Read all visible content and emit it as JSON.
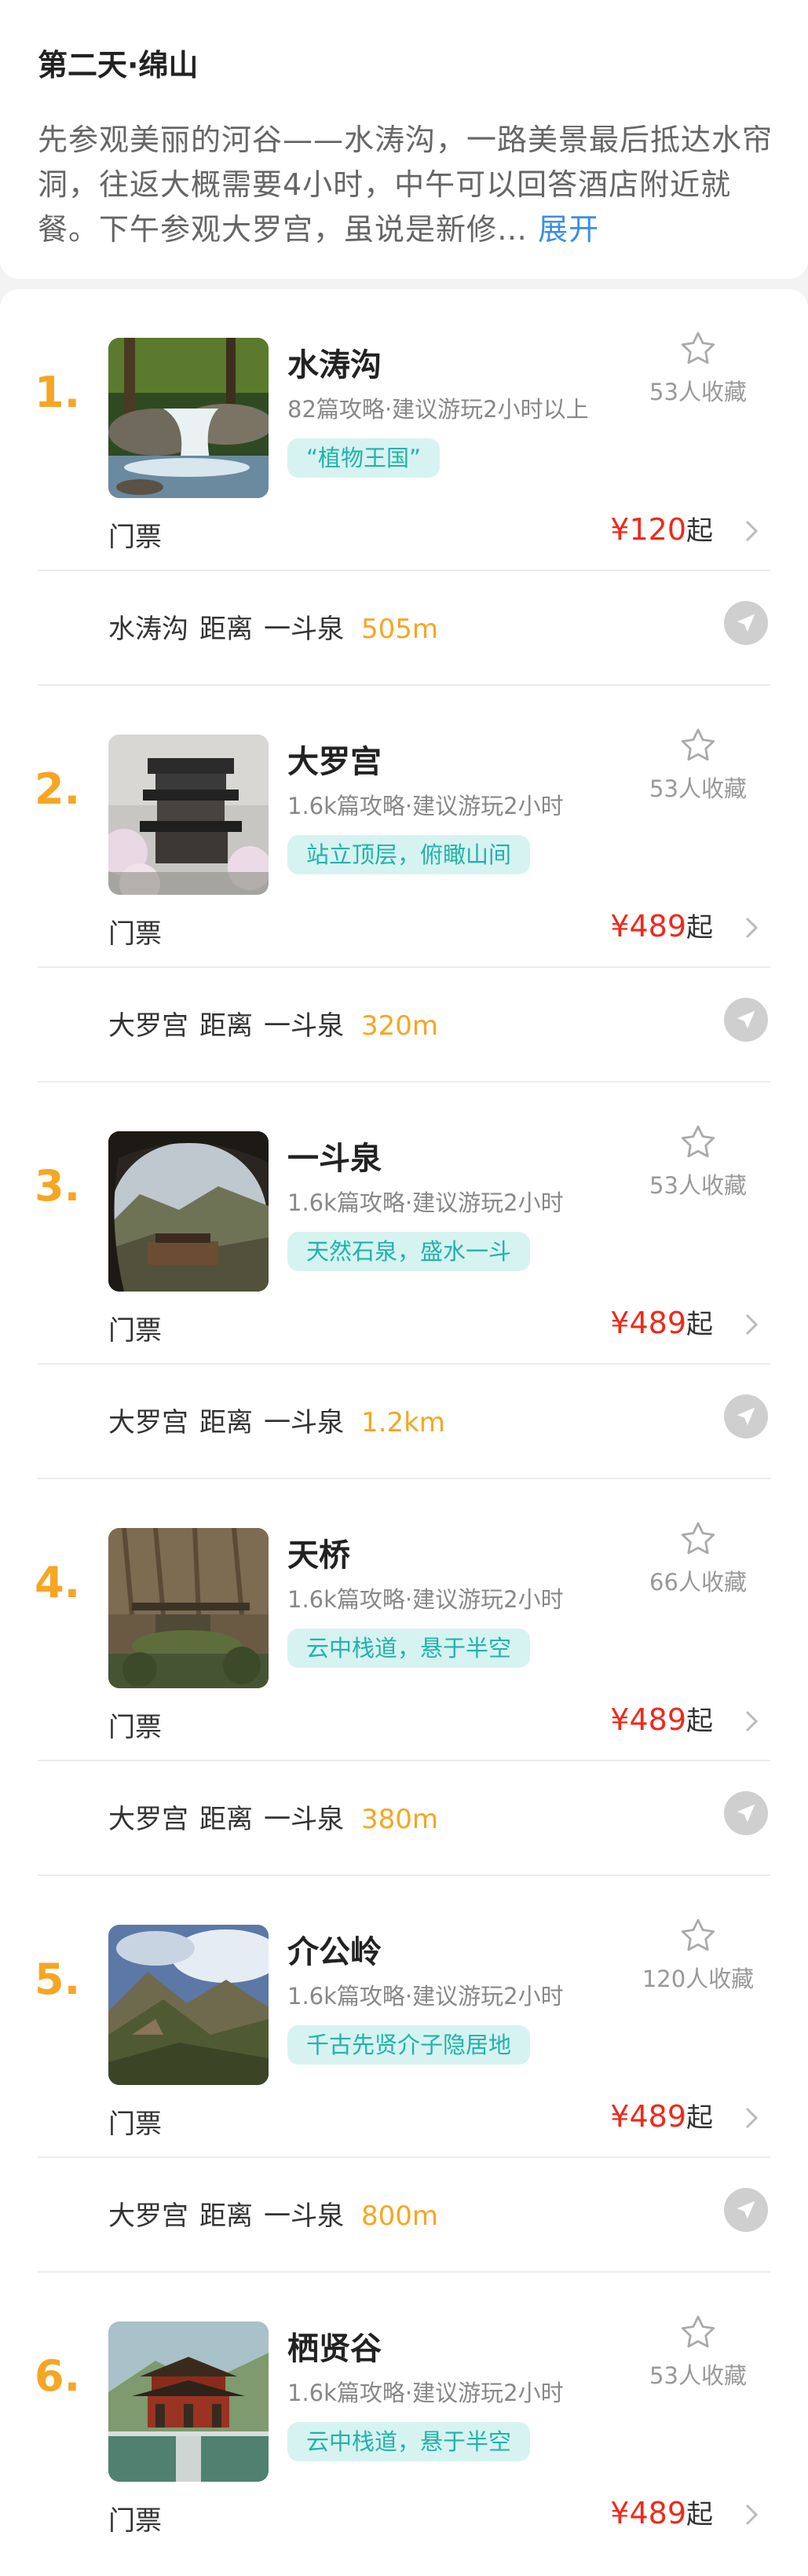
{
  "day": {
    "title": "第二天·绵山",
    "description": "先参观美丽的河谷——水涛沟，一路美景最后抵达水帘洞，往返大概需要4小时，中午可以回答酒店附近就餐。下午参观大罗宫，虽说是新修…",
    "expand_label": "展开"
  },
  "labels": {
    "ticket": "门票",
    "price_prefix": "¥",
    "price_suffix": "起",
    "distance_word": "距离"
  },
  "colors": {
    "accent_orange": "#f6a623",
    "price_red": "#f0291b",
    "tag_teal": "#20b3ab",
    "tag_bg": "#d7f3f1"
  },
  "spots": [
    {
      "number": "1.",
      "name": "水涛沟",
      "meta": "82篇攻略·建议游玩2小时以上",
      "tag": "“植物王国”",
      "favorites": "53人收藏",
      "price": "120",
      "distance": {
        "from": "水涛沟",
        "to": "一斗泉",
        "value": "505m"
      },
      "image": "waterfall"
    },
    {
      "number": "2.",
      "name": "大罗宫",
      "meta": "1.6k篇攻略·建议游玩2小时",
      "tag": "站立顶层，俯瞰山间",
      "favorites": "53人收藏",
      "price": "489",
      "distance": {
        "from": "大罗宫",
        "to": "一斗泉",
        "value": "320m"
      },
      "image": "pagoda"
    },
    {
      "number": "3.",
      "name": "一斗泉",
      "meta": "1.6k篇攻略·建议游玩2小时",
      "tag": "天然石泉，盛水一斗",
      "favorites": "53人收藏",
      "price": "489",
      "distance": {
        "from": "大罗宫",
        "to": "一斗泉",
        "value": "1.2km"
      },
      "image": "cave"
    },
    {
      "number": "4.",
      "name": "天桥",
      "meta": "1.6k篇攻略·建议游玩2小时",
      "tag": "云中栈道，悬于半空",
      "favorites": "66人收藏",
      "price": "489",
      "distance": {
        "from": "大罗宫",
        "to": "一斗泉",
        "value": "380m"
      },
      "image": "cliff"
    },
    {
      "number": "5.",
      "name": "介公岭",
      "meta": "1.6k篇攻略·建议游玩2小时",
      "tag": "千古先贤介子隐居地",
      "favorites": "120人收藏",
      "price": "489",
      "distance": {
        "from": "大罗宫",
        "to": "一斗泉",
        "value": "800m"
      },
      "image": "mountain"
    },
    {
      "number": "6.",
      "name": "栖贤谷",
      "meta": "1.6k篇攻略·建议游玩2小时",
      "tag": "云中栈道，悬于半空",
      "favorites": "53人收藏",
      "price": "489",
      "distance": null,
      "image": "temple"
    }
  ]
}
